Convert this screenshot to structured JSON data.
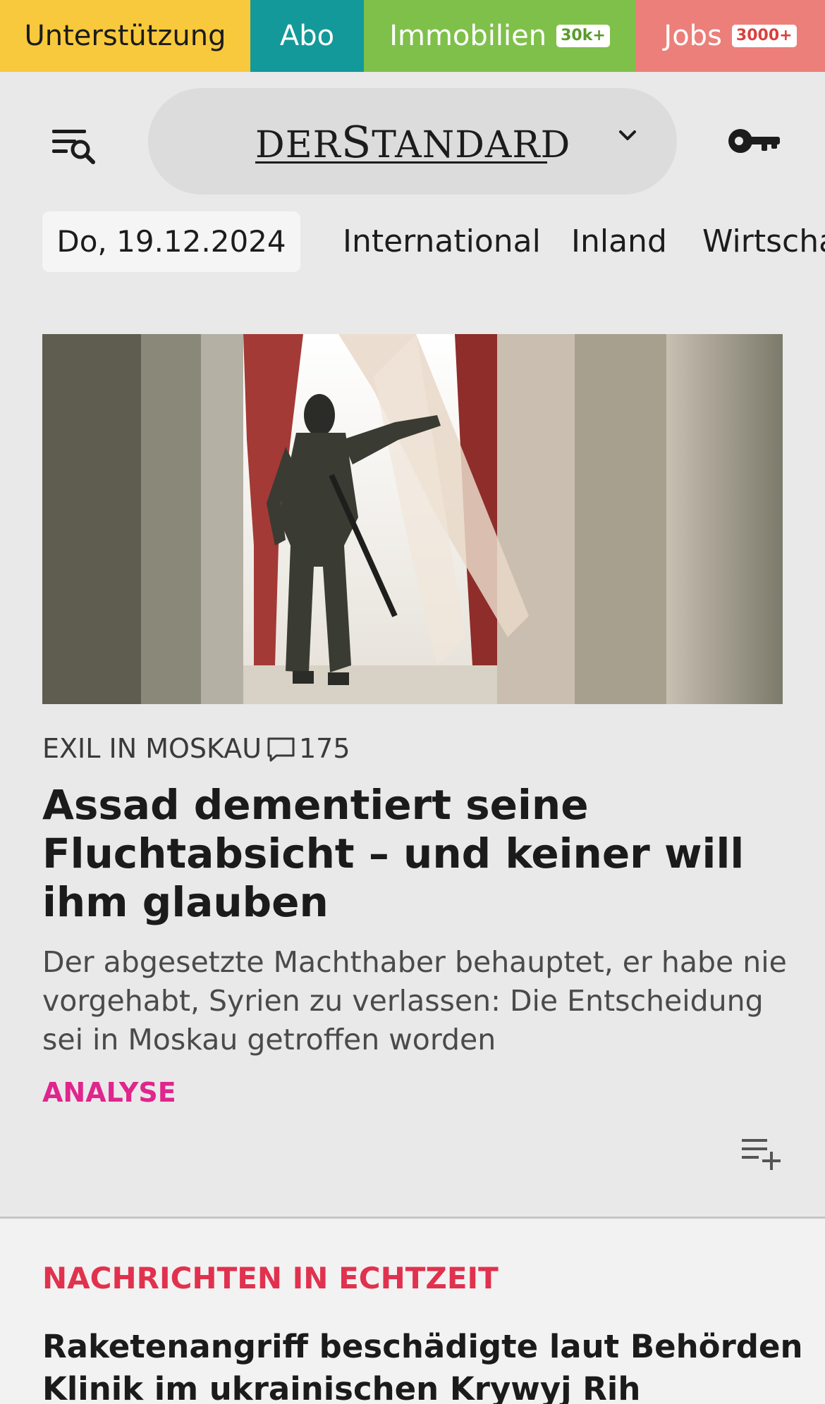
{
  "topbar": {
    "support_label": "Unterstützung",
    "abo_label": "Abo",
    "immobilien_label": "Immobilien",
    "immobilien_badge": "30k+",
    "jobs_label": "Jobs",
    "jobs_badge": "3000+",
    "colors": {
      "support": "#f8c93c",
      "abo": "#13999a",
      "immobilien": "#7fc04a",
      "jobs": "#ec7f7a"
    }
  },
  "header": {
    "logo_left": "DER",
    "logo_s": "S",
    "logo_mid": "TANDAR",
    "logo_d": "D",
    "menu_icon": "menu-search-icon",
    "dropdown_icon": "chevron-down-icon",
    "login_icon": "key-icon"
  },
  "nav": {
    "date": "Do, 19.12.2024",
    "items": [
      "International",
      "Inland",
      "Wirtschaft"
    ]
  },
  "article": {
    "kicker": "EXIL IN MOSKAU",
    "comment_count": "175",
    "headline": "Assad dementiert seine Fluchtabsicht – und keiner will ihm glauben",
    "teaser": "Der abgesetzte Machthaber behauptet, er habe nie vorgehabt, Syrien zu verlassen: Die Entscheidung sei in Moskau getroffen worden",
    "tag": "ANALYSE",
    "tag_color": "#e0258d",
    "playlist_icon": "playlist-add-icon"
  },
  "live": {
    "title": "NACHRICHTEN IN ECHTZEIT",
    "headline": "Raketenangriff beschädigte laut Behörden Klinik im ukrainischen Krywyj Rih"
  }
}
